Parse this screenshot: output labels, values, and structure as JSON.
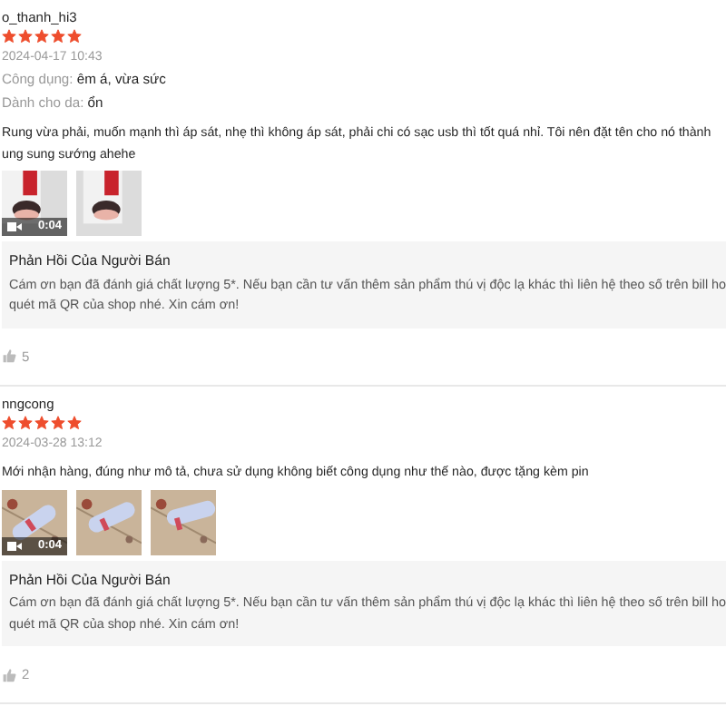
{
  "reviews": [
    {
      "username": "o_thanh_hi3",
      "stars": 5,
      "date": "2024-04-17 10:43",
      "attributes": [
        {
          "label": "Công dụng:",
          "value": "êm á, vừa sức"
        },
        {
          "label": "Dành cho da:",
          "value": "ổn"
        }
      ],
      "comment_lines": [
        "Rung vừa phải, muốn mạnh thì áp sát, nhẹ thì không áp sát, phải chi có sạc usb thì tốt quá nhỉ. Tôi nên đặt tên cho nó thành",
        "ung sung sướng ahehe"
      ],
      "media": [
        {
          "kind": "video",
          "duration": "0:04"
        },
        {
          "kind": "picture"
        }
      ],
      "seller_reply": {
        "title": "Phản Hồi Của Người Bán",
        "lines": [
          "Cám ơn bạn đã đánh giá chất lượng 5*. Nếu bạn cần tư vấn thêm sản phẩm thú vị độc lạ khác thì liên hệ theo số trên bill ho",
          "quét mã QR của shop nhé. Xin cám ơn!"
        ]
      },
      "likes": "5"
    },
    {
      "username": "nngcong",
      "stars": 5,
      "date": "2024-03-28 13:12",
      "comment_lines": [
        "Mới nhận hàng, đúng như mô tả, chưa sử dụng không biết công dụng như thế nào, được tặng kèm pin"
      ],
      "media": [
        {
          "kind": "video",
          "duration": "0:04"
        },
        {
          "kind": "picture"
        },
        {
          "kind": "picture"
        }
      ],
      "seller_reply": {
        "title": "Phản Hồi Của Người Bán",
        "lines": [
          "Cám ơn bạn đã đánh giá chất lượng 5*. Nếu bạn cần tư vấn thêm sản phẩm thú vị độc lạ khác thì liên hệ theo số trên bill ho",
          "quét mã QR của shop nhé. Xin cám ơn!"
        ]
      },
      "likes": "2"
    }
  ]
}
